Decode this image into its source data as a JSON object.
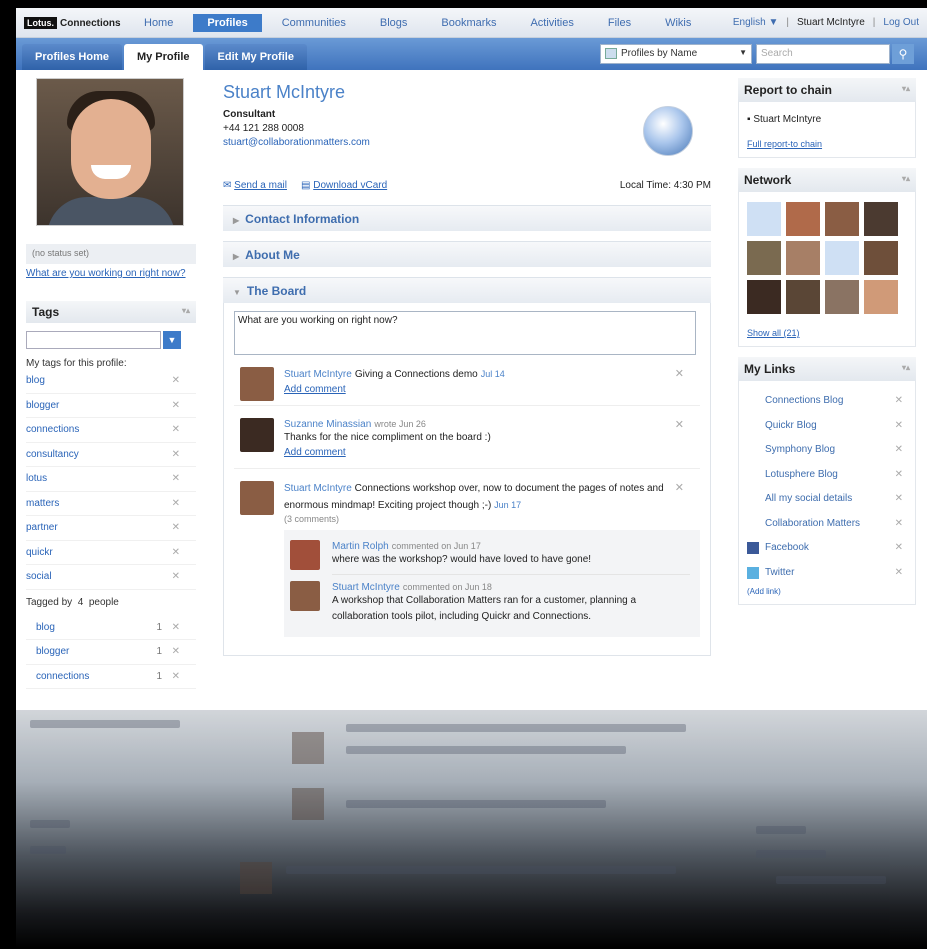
{
  "app": {
    "logo_lotus": "Lotus.",
    "logo_name": "Connections"
  },
  "nav": [
    "Home",
    "Profiles",
    "Communities",
    "Blogs",
    "Bookmarks",
    "Activities",
    "Files",
    "Wikis"
  ],
  "nav_active": 1,
  "topright": {
    "language": "English ▼",
    "user": "Stuart McIntyre",
    "logout": "Log Out"
  },
  "tabs": [
    "Profiles Home",
    "My Profile",
    "Edit My Profile"
  ],
  "search": {
    "scope": "Profiles by Name",
    "placeholder": "Search"
  },
  "profile": {
    "name": "Stuart McIntyre",
    "title": "Consultant",
    "phone": "+44 121 288 0008",
    "email": "stuart@collaborationmatters.com",
    "local_time": "Local Time: 4:30 PM",
    "send_mail": "Send a mail",
    "download_vcard": "Download vCard",
    "status": "(no status set)",
    "working_link": "What are you working on right now?"
  },
  "sections": {
    "contact": "Contact Information",
    "about": "About Me",
    "board": "The Board"
  },
  "board": {
    "input": "What are you working on right now?",
    "posts": [
      {
        "who": "Stuart McIntyre",
        "msg": "Giving a Connections demo",
        "date": "Jul 14",
        "add": "Add comment"
      },
      {
        "who": "Suzanne Minassian",
        "wrote": "wrote Jun 26",
        "msg": "Thanks for the nice compliment on the board :)",
        "add": "Add comment"
      },
      {
        "who": "Stuart McIntyre",
        "msg": "Connections workshop over, now to document the pages of notes and enormous mindmap! Exciting project though ;-)",
        "date": "Jun 17",
        "count": "(3 comments)"
      }
    ],
    "comments": [
      {
        "who": "Martin Rolph",
        "meta": "commented on Jun 17",
        "msg": "where was the workshop? would have loved to have gone!"
      },
      {
        "who": "Stuart McIntyre",
        "meta": "commented on Jun 18",
        "msg": "A workshop that Collaboration Matters ran for a customer, planning a collaboration tools pilot, including Quickr and Connections."
      }
    ]
  },
  "tags": {
    "title": "Tags",
    "my_label": "My tags for this profile:",
    "mine": [
      "blog",
      "blogger",
      "connections",
      "consultancy",
      "lotus",
      "matters",
      "partner",
      "quickr",
      "social"
    ],
    "tagged_by": "Tagged by",
    "tagged_count": "4",
    "tagged_suffix": "people",
    "others": [
      {
        "tag": "blog",
        "n": "1"
      },
      {
        "tag": "blogger",
        "n": "1"
      },
      {
        "tag": "connections",
        "n": "1"
      }
    ]
  },
  "report": {
    "title": "Report to chain",
    "person": "Stuart McIntyre",
    "full": "Full report-to chain"
  },
  "network": {
    "title": "Network",
    "show_all": "Show all (21)",
    "colors": [
      "#cfe0f4",
      "#b06a4a",
      "#8a5d44",
      "#4b3a30",
      "#7a6a50",
      "#a77f66",
      "#cfe0f4",
      "#6e4f3a",
      "#3b2a22",
      "#5a4636",
      "#8a7363",
      "#d09a78"
    ]
  },
  "links": {
    "title": "My Links",
    "items": [
      "Connections Blog",
      "Quickr Blog",
      "Symphony Blog",
      "Lotusphere Blog",
      "All my social details",
      "Collaboration Matters",
      "Facebook",
      "Twitter"
    ],
    "add_more": "(Add link)"
  }
}
